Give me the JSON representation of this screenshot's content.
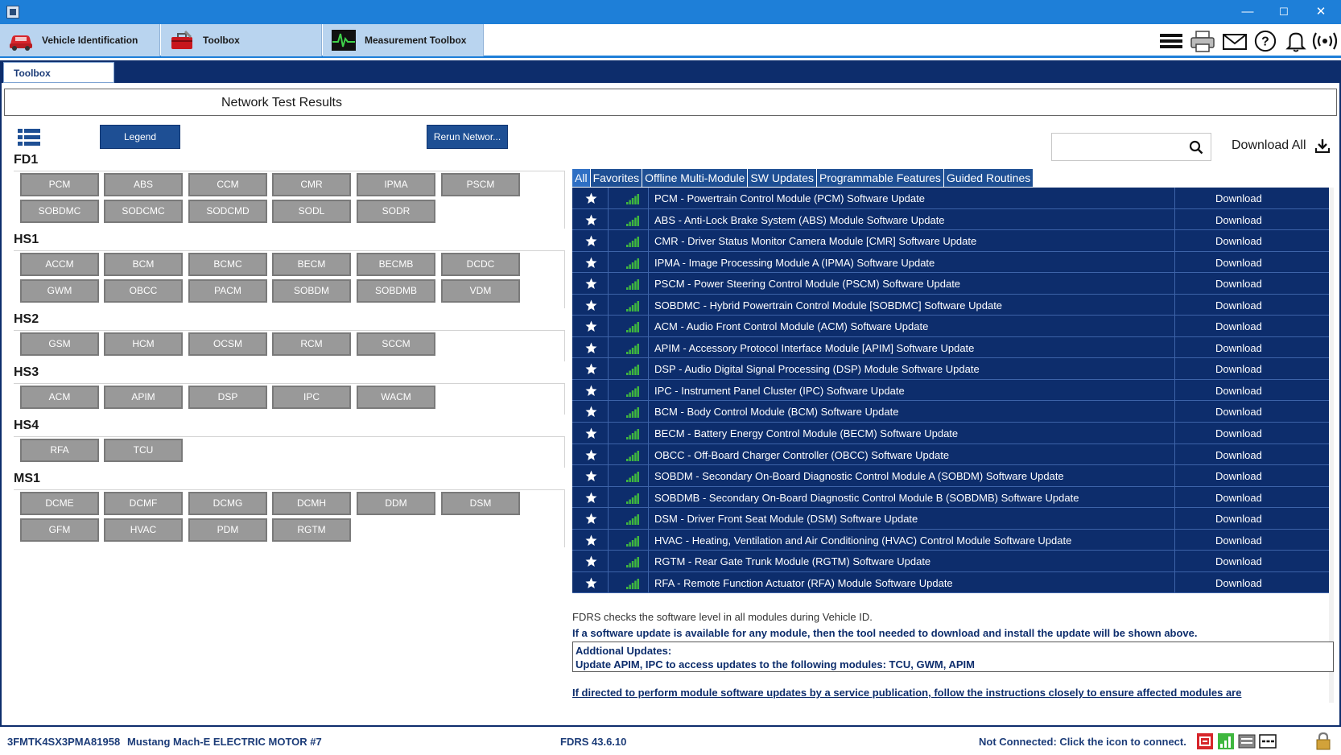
{
  "window": {
    "minimize": "—",
    "maximize": "☐",
    "close": "✕"
  },
  "main_tabs": [
    {
      "label": "Vehicle Identification",
      "icon": "car-icon"
    },
    {
      "label": "Toolbox",
      "icon": "toolbox-icon"
    },
    {
      "label": "Measurement Toolbox",
      "icon": "oscilloscope-icon"
    }
  ],
  "toolbar_icons": [
    "menu-icon",
    "printer-icon",
    "mail-icon",
    "help-icon",
    "bell-icon",
    "wireless-icon"
  ],
  "subtab": {
    "label": "Toolbox"
  },
  "page_title": "Network Test Results",
  "buttons": {
    "legend": "Legend",
    "rerun": "Rerun Networ..."
  },
  "module_groups": [
    {
      "name": "FD1",
      "modules": [
        "PCM",
        "ABS",
        "CCM",
        "CMR",
        "IPMA",
        "PSCM",
        "SOBDMC",
        "SODCMC",
        "SODCMD",
        "SODL",
        "SODR"
      ]
    },
    {
      "name": "HS1",
      "modules": [
        "ACCM",
        "BCM",
        "BCMC",
        "BECM",
        "BECMB",
        "DCDC",
        "GWM",
        "OBCC",
        "PACM",
        "SOBDM",
        "SOBDMB",
        "VDM"
      ]
    },
    {
      "name": "HS2",
      "modules": [
        "GSM",
        "HCM",
        "OCSM",
        "RCM",
        "SCCM"
      ]
    },
    {
      "name": "HS3",
      "modules": [
        "ACM",
        "APIM",
        "DSP",
        "IPC",
        "WACM"
      ]
    },
    {
      "name": "HS4",
      "modules": [
        "RFA",
        "TCU"
      ]
    },
    {
      "name": "MS1",
      "modules": [
        "DCME",
        "DCMF",
        "DCMG",
        "DCMH",
        "DDM",
        "DSM",
        "GFM",
        "HVAC",
        "PDM",
        "RGTM"
      ]
    }
  ],
  "search": {
    "value": "",
    "placeholder": ""
  },
  "download_all": "Download All",
  "filter_tabs": [
    "All",
    "Favorites",
    "Offline Multi-Module",
    "SW Updates",
    "Programmable Features",
    "Guided Routines"
  ],
  "updates": [
    {
      "description": "PCM - Powertrain Control Module (PCM) Software Update",
      "action": "Download"
    },
    {
      "description": "ABS - Anti-Lock Brake System (ABS) Module Software Update",
      "action": "Download"
    },
    {
      "description": "CMR - Driver Status Monitor Camera Module [CMR] Software Update",
      "action": "Download"
    },
    {
      "description": "IPMA - Image Processing Module A (IPMA) Software Update",
      "action": "Download"
    },
    {
      "description": "PSCM - Power Steering Control Module (PSCM) Software Update",
      "action": "Download"
    },
    {
      "description": "SOBDMC - Hybrid Powertrain Control Module [SOBDMC] Software Update",
      "action": "Download"
    },
    {
      "description": "ACM - Audio Front Control Module (ACM) Software Update",
      "action": "Download"
    },
    {
      "description": "APIM - Accessory Protocol Interface Module [APIM] Software Update",
      "action": "Download"
    },
    {
      "description": "DSP - Audio Digital Signal Processing (DSP) Module Software Update",
      "action": "Download"
    },
    {
      "description": "IPC - Instrument Panel Cluster (IPC) Software Update",
      "action": "Download"
    },
    {
      "description": "BCM - Body Control Module (BCM) Software Update",
      "action": "Download"
    },
    {
      "description": "BECM - Battery Energy Control Module (BECM) Software Update",
      "action": "Download"
    },
    {
      "description": "OBCC - Off-Board Charger Controller (OBCC) Software Update",
      "action": "Download"
    },
    {
      "description": "SOBDM - Secondary On-Board Diagnostic Control Module A (SOBDM) Software Update",
      "action": "Download"
    },
    {
      "description": "SOBDMB - Secondary On-Board Diagnostic Control Module B (SOBDMB) Software Update",
      "action": "Download"
    },
    {
      "description": "DSM - Driver Front Seat Module (DSM) Software Update",
      "action": "Download"
    },
    {
      "description": "HVAC - Heating, Ventilation and Air Conditioning (HVAC) Control Module Software Update",
      "action": "Download"
    },
    {
      "description": "RGTM - Rear Gate Trunk Module (RGTM) Software Update",
      "action": "Download"
    },
    {
      "description": "RFA - Remote Function Actuator (RFA) Module Software Update",
      "action": "Download"
    }
  ],
  "info": {
    "line1": "FDRS checks the software level in all modules during Vehicle ID.",
    "line2": "If a software update is available for any module, then the tool needed to download and install the update will be shown above.",
    "additional_heading": "Addtional Updates:",
    "additional_text": "Update APIM, IPC to access updates to the following modules: TCU, GWM, APIM",
    "link": "If directed to perform module software updates by a service publication, follow the instructions closely to ensure affected modules are"
  },
  "status": {
    "vin": "3FMTK4SX3PMA81958",
    "vehicle": "Mustang Mach-E ELECTRIC MOTOR #7",
    "version": "FDRS 43.6.10",
    "connection": "Not Connected: Click the icon to connect."
  },
  "colors": {
    "accent": "#1e7fd8",
    "navy": "#0d2d6c",
    "module_gray": "#999999",
    "signal_green": "#3fb73f"
  }
}
